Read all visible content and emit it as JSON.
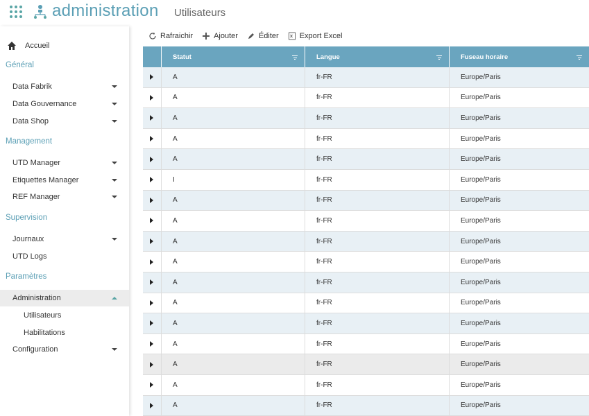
{
  "header": {
    "app_title": "administration",
    "page_title": "Utilisateurs",
    "grid_icon": "apps-grid-icon",
    "logo_icon": "org-chart-icon"
  },
  "sidebar": {
    "home": {
      "label": "Accueil",
      "icon": "home-icon"
    },
    "sections": [
      {
        "title": "Général",
        "items": [
          {
            "label": "Data Fabrik",
            "expanded": false
          },
          {
            "label": "Data Gouvernance",
            "expanded": false
          },
          {
            "label": "Data Shop",
            "expanded": false
          }
        ]
      },
      {
        "title": "Management",
        "items": [
          {
            "label": "UTD Manager",
            "expanded": false
          },
          {
            "label": "Etiquettes Manager",
            "expanded": false
          },
          {
            "label": "REF Manager",
            "expanded": false
          }
        ]
      },
      {
        "title": "Supervision",
        "items": [
          {
            "label": "Journaux",
            "expanded": false
          },
          {
            "label": "UTD Logs"
          }
        ]
      },
      {
        "title": "Paramètres",
        "items": [
          {
            "label": "Administration",
            "expanded": true,
            "active": true,
            "children": [
              {
                "label": "Utilisateurs"
              },
              {
                "label": "Habilitations"
              }
            ]
          },
          {
            "label": "Configuration",
            "expanded": false
          }
        ]
      }
    ]
  },
  "toolbar": {
    "refresh_label": "Rafraichir",
    "add_label": "Ajouter",
    "edit_label": "Éditer",
    "export_label": "Export Excel"
  },
  "grid": {
    "columns": [
      "Statut",
      "Langue",
      "Fuseau horaire"
    ],
    "rows": [
      [
        "A",
        "fr-FR",
        "Europe/Paris"
      ],
      [
        "A",
        "fr-FR",
        "Europe/Paris"
      ],
      [
        "A",
        "fr-FR",
        "Europe/Paris"
      ],
      [
        "A",
        "fr-FR",
        "Europe/Paris"
      ],
      [
        "A",
        "fr-FR",
        "Europe/Paris"
      ],
      [
        "I",
        "fr-FR",
        "Europe/Paris"
      ],
      [
        "A",
        "fr-FR",
        "Europe/Paris"
      ],
      [
        "A",
        "fr-FR",
        "Europe/Paris"
      ],
      [
        "A",
        "fr-FR",
        "Europe/Paris"
      ],
      [
        "A",
        "fr-FR",
        "Europe/Paris"
      ],
      [
        "A",
        "fr-FR",
        "Europe/Paris"
      ],
      [
        "A",
        "fr-FR",
        "Europe/Paris"
      ],
      [
        "A",
        "fr-FR",
        "Europe/Paris"
      ],
      [
        "A",
        "fr-FR",
        "Europe/Paris"
      ],
      [
        "A",
        "fr-FR",
        "Europe/Paris"
      ],
      [
        "A",
        "fr-FR",
        "Europe/Paris"
      ],
      [
        "A",
        "fr-FR",
        "Europe/Paris"
      ]
    ],
    "selected_row": 14
  },
  "colors": {
    "accent": "#5b9fb5",
    "header_bg": "#6aa5bf",
    "row_alt": "#e8f0f5"
  }
}
